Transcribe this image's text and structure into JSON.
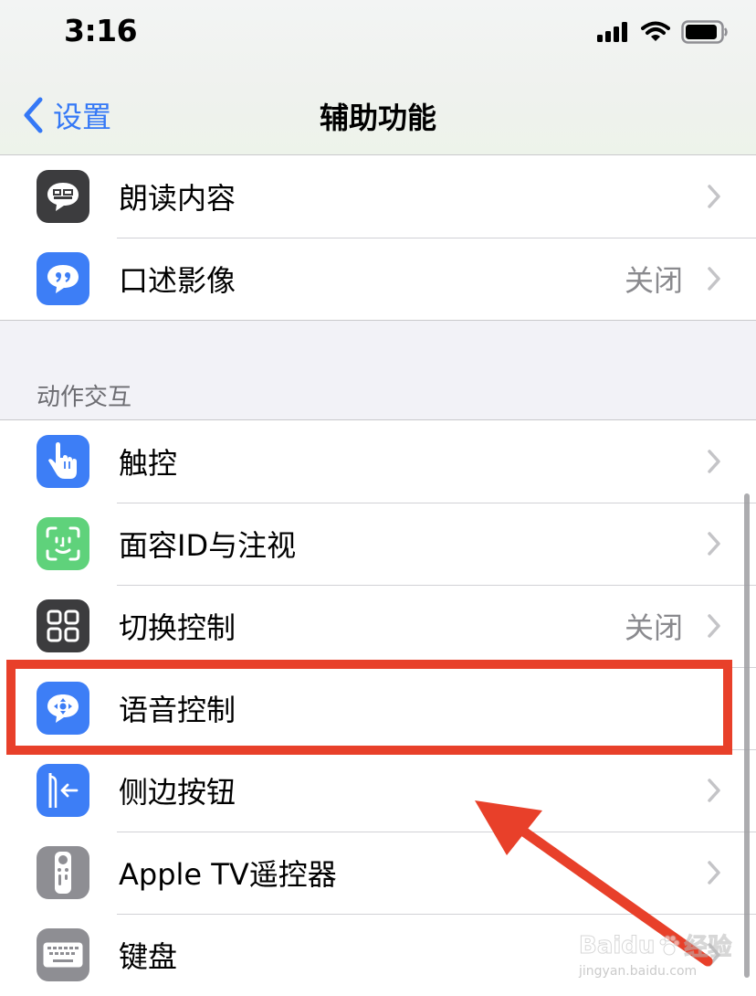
{
  "status_bar": {
    "time": "3:16"
  },
  "nav": {
    "back_label": "设置",
    "title": "辅助功能"
  },
  "top_group": [
    {
      "label": "朗读内容",
      "value": "",
      "icon": "speech-bubble-icon",
      "color": "#3c3c3e"
    },
    {
      "label": "口述影像",
      "value": "关闭",
      "icon": "quote-bubble-icon",
      "color": "#3d7ef6"
    }
  ],
  "section": {
    "header": "动作交互"
  },
  "interaction_group": [
    {
      "label": "触控",
      "value": "",
      "icon": "hand-touch-icon",
      "color": "#3d7ef6"
    },
    {
      "label": "面容ID与注视",
      "value": "",
      "icon": "face-id-icon",
      "color": "#5fd27b"
    },
    {
      "label": "切换控制",
      "value": "关闭",
      "icon": "grid-squares-icon",
      "color": "#3c3c3e"
    },
    {
      "label": "语音控制",
      "value": "",
      "icon": "voice-control-icon",
      "color": "#3d7ef6"
    },
    {
      "label": "侧边按钮",
      "value": "",
      "icon": "side-button-icon",
      "color": "#3d7ef6"
    },
    {
      "label": "Apple TV遥控器",
      "value": "",
      "icon": "tv-remote-icon",
      "color": "#8e8e93"
    },
    {
      "label": "键盘",
      "value": "",
      "icon": "keyboard-icon",
      "color": "#8e8e93"
    }
  ],
  "watermark": {
    "brand": "Baidu",
    "suffix": "经验",
    "url": "jingyan.baidu.com"
  }
}
